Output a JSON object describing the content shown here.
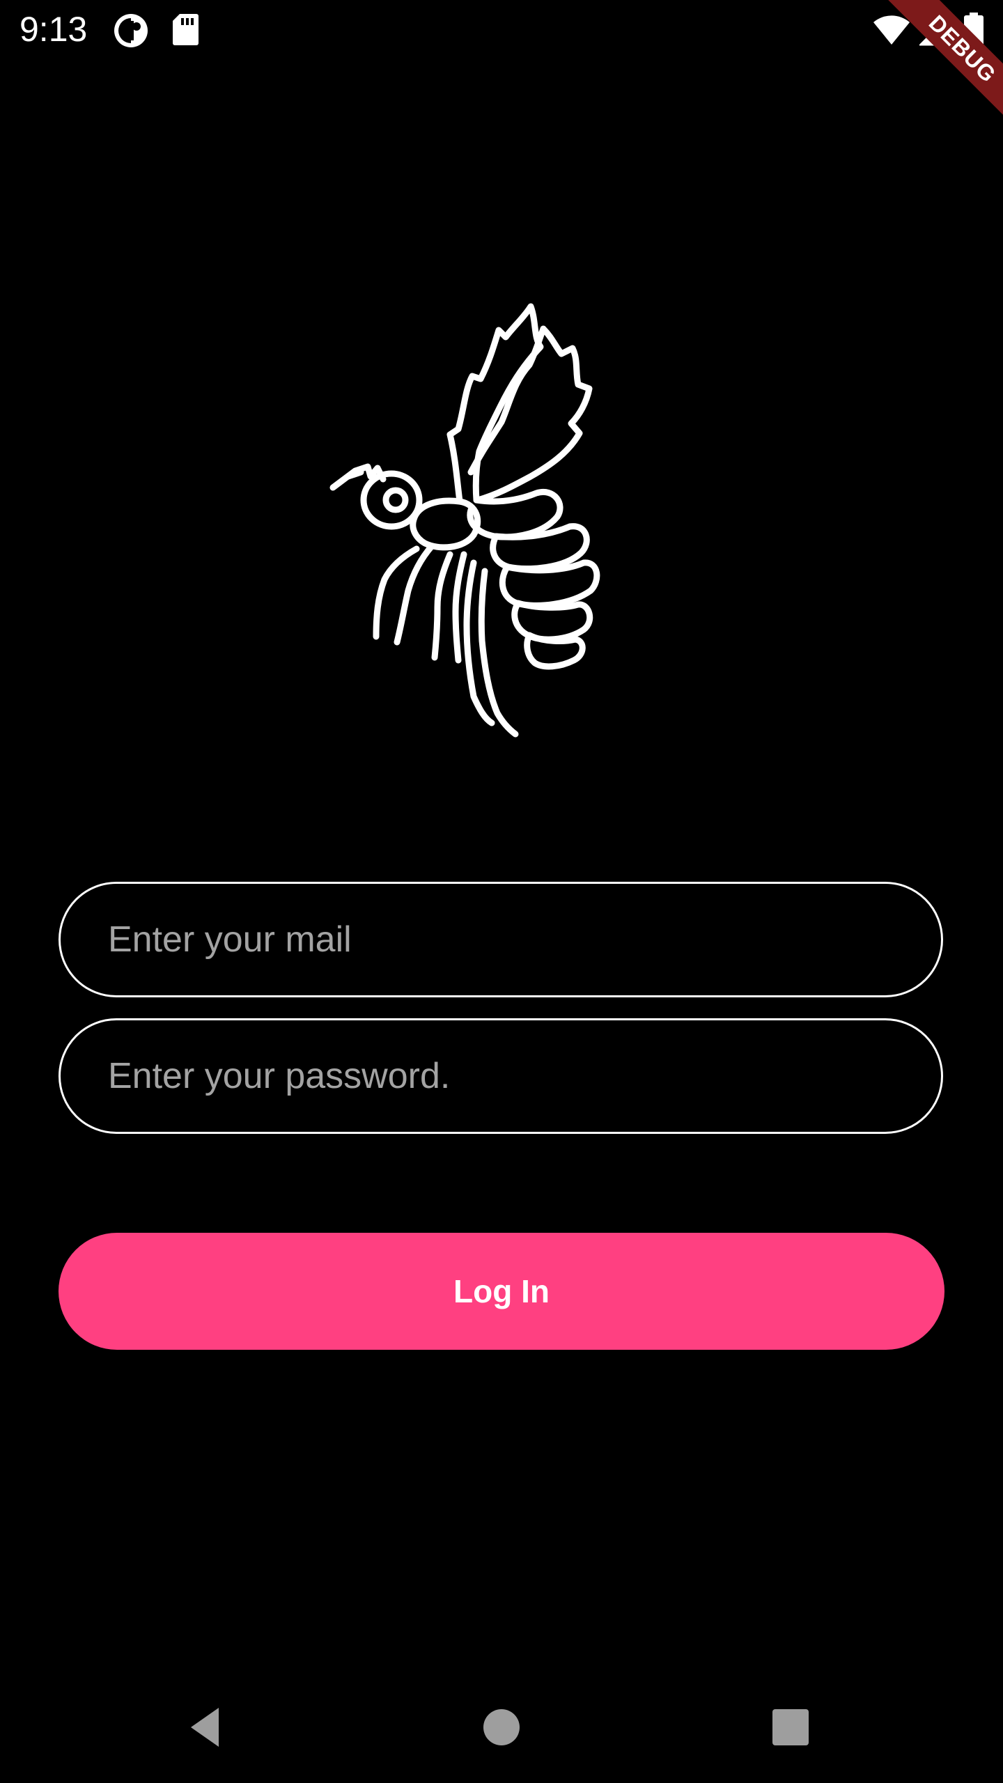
{
  "status_bar": {
    "time": "9:13",
    "icons": [
      "data-saver-icon",
      "sd-card-icon",
      "wifi-icon",
      "signal-icon",
      "battery-icon"
    ],
    "debug_label": "DEBUG"
  },
  "logo": {
    "icon": "bee-icon"
  },
  "form": {
    "email_placeholder": "Enter your mail",
    "email_value": "",
    "password_placeholder": "Enter your password.",
    "password_value": "",
    "login_label": "Log In"
  },
  "nav_bar": {
    "icons": [
      "back-icon",
      "home-icon",
      "recents-icon"
    ]
  },
  "colors": {
    "background": "#000000",
    "accent": "#ff4081",
    "field_border": "#ffffff",
    "placeholder": "#a3a3a3",
    "debug_ribbon": "#7d1a1a",
    "nav_icons": "#9e9e9e"
  }
}
